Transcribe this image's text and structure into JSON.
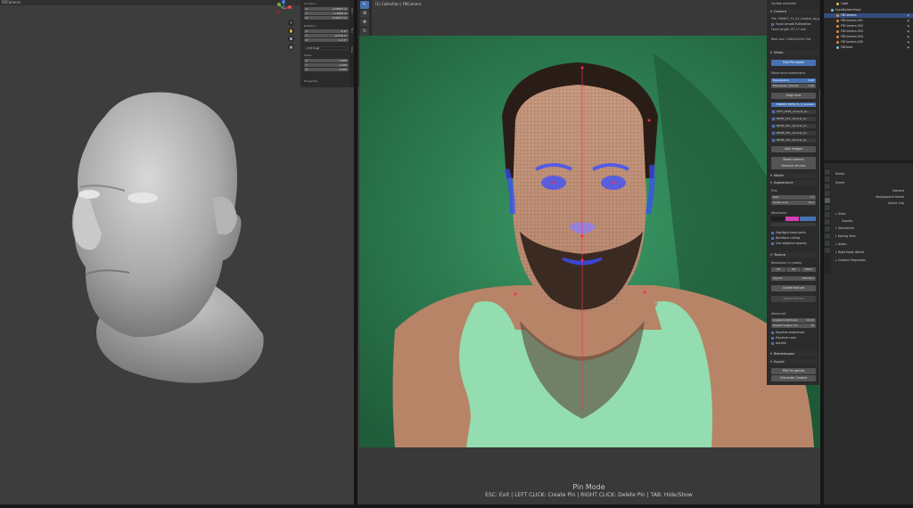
{
  "left_viewport": {
    "header_title": "FBCamera",
    "n_panel": {
      "location_label": "Location:",
      "location": [
        {
          "axis": "X",
          "value": "0.78087 m"
        },
        {
          "axis": "Y",
          "value": "-1.2855 m"
        },
        {
          "axis": "Z",
          "value": "0.00471 m"
        }
      ],
      "rotation_label": "Rotation:",
      "rotation": [
        {
          "axis": "X",
          "value": "-1.9°"
        },
        {
          "axis": "Y",
          "value": "-0.134 1°"
        },
        {
          "axis": "Z",
          "value": "-1.9 4°"
        }
      ],
      "rotation_mode": "XYZ Euler",
      "scale_label": "Scale:",
      "scale": [
        {
          "axis": "X",
          "value": "1.000"
        },
        {
          "axis": "Y",
          "value": "1.000"
        },
        {
          "axis": "Z",
          "value": "1.000"
        }
      ],
      "properties_label": "Properties"
    },
    "tabs": [
      "Item",
      "Tool",
      "View"
    ]
  },
  "camera_viewport": {
    "header_title": "(1) Collection | FBCamera",
    "mode_title": "Pin Mode",
    "hint": "ESC: Exit | LEFT CLICK: Create Pin | RIGHT CLICK: Delete Pin | TAB: Hide/Show",
    "tools": [
      "select",
      "cursor",
      "move",
      "rotate",
      "scale",
      "annotate",
      "measure",
      "add"
    ],
    "tabs": [
      "Item",
      "Tool",
      "View",
      "FaceBuilder"
    ]
  },
  "facebuilder_panel": {
    "update_label": "Update available",
    "camera_section": "Camera",
    "camera_file": "File: FB0807_FL_h4_shaded_bg.jpg",
    "focal_estimation": "Focal Length Estimation",
    "focal_length": "Focal length: 67.17 mm",
    "real_size": "Real size: 1563x2x23x Flat",
    "views_section": "Views",
    "exit_pin_mode": "Exit Pin mode",
    "move_focal": "Move focal expressions",
    "expr1": "Expressions",
    "expr1_value": "0.00",
    "expr2": "Expression strengt..",
    "expr2_value": "1.00",
    "align_face": "Align face",
    "images": [
      "FB0807_EXTR_FL_4_shaded...",
      "LEFT_0038_visceral_sk...",
      "REVB_013_visceral_sk...",
      "REVB_021_visceral_sk...",
      "REVB_022_visceral_sk...",
      "REVB_032_visceral_sk..."
    ],
    "add_images": "Add Images",
    "reset_camera": "Reset camera",
    "remove_all_pins": "Remove all pins",
    "model_section": "Model",
    "appearance_section": "Appearance",
    "pins_label": "Pins",
    "pin_size": "Size",
    "pin_size_value": "7.0",
    "pin_active": "Active area",
    "pin_active_value": "10.0",
    "wireframe_label": "Wireframe",
    "highlight_head": "Highlight head parts",
    "backface_culling": "Backface culling",
    "adaptive_opacity": "Use adaptive opacity",
    "texture_section": "Texture",
    "resolution": "Resolution (in pixels)",
    "res_options": [
      "2K",
      "4K",
      "Other"
    ],
    "layout": "Layout",
    "layout_value": "Interface",
    "create_texture": "Create texture",
    "apply_texture": "Apply texture",
    "advanced_label": "Advanced",
    "brightness": "Angled brightness",
    "brightness_value": "10.00",
    "equalize": "Expand edges (%)",
    "equalize_value": "10",
    "equalize_brightness": "Equalize brightness",
    "equalize_color": "Equalize color",
    "autofill": "Autofill",
    "blendshapes_section": "Blendshapes",
    "export_section": "Export",
    "fbx_for_games": "FBX for games",
    "character_creator": "Character Creator"
  },
  "outliner": {
    "rows": [
      {
        "label": "Light",
        "color": "#e8c05a",
        "indent": 4
      },
      {
        "label": "FaceBuilderHead",
        "color": "#7dc2e4",
        "indent": 2
      },
      {
        "label": "FBCamera",
        "color": "#e08a3b",
        "indent": 4,
        "selected": true
      },
      {
        "label": "FBCamera.001",
        "color": "#e08a3b",
        "indent": 4
      },
      {
        "label": "FBCamera.002",
        "color": "#e08a3b",
        "indent": 4
      },
      {
        "label": "FBCamera.003",
        "color": "#e08a3b",
        "indent": 4
      },
      {
        "label": "FBCamera.004",
        "color": "#e08a3b",
        "indent": 4
      },
      {
        "label": "FBCamera.005",
        "color": "#e08a3b",
        "indent": 4
      },
      {
        "label": "FBHead",
        "color": "#7dc2e4",
        "indent": 4
      }
    ]
  },
  "properties": {
    "scene_label": "Scene",
    "scene_sub": "Scene",
    "camera_label": "Camera",
    "bg_scene_label": "Background Scene",
    "active_clip_label": "Active Clip",
    "sections": [
      "Units",
      "Gravity",
      "Simulation",
      "Keying Sets",
      "Audio",
      "Rigid Body World",
      "Custom Properties"
    ]
  },
  "colors": {
    "accent": "#4772b3",
    "green_screen": "#2f7a4f",
    "mesh_blue": "#3a4dff",
    "pin_red": "#ff2a4a"
  }
}
